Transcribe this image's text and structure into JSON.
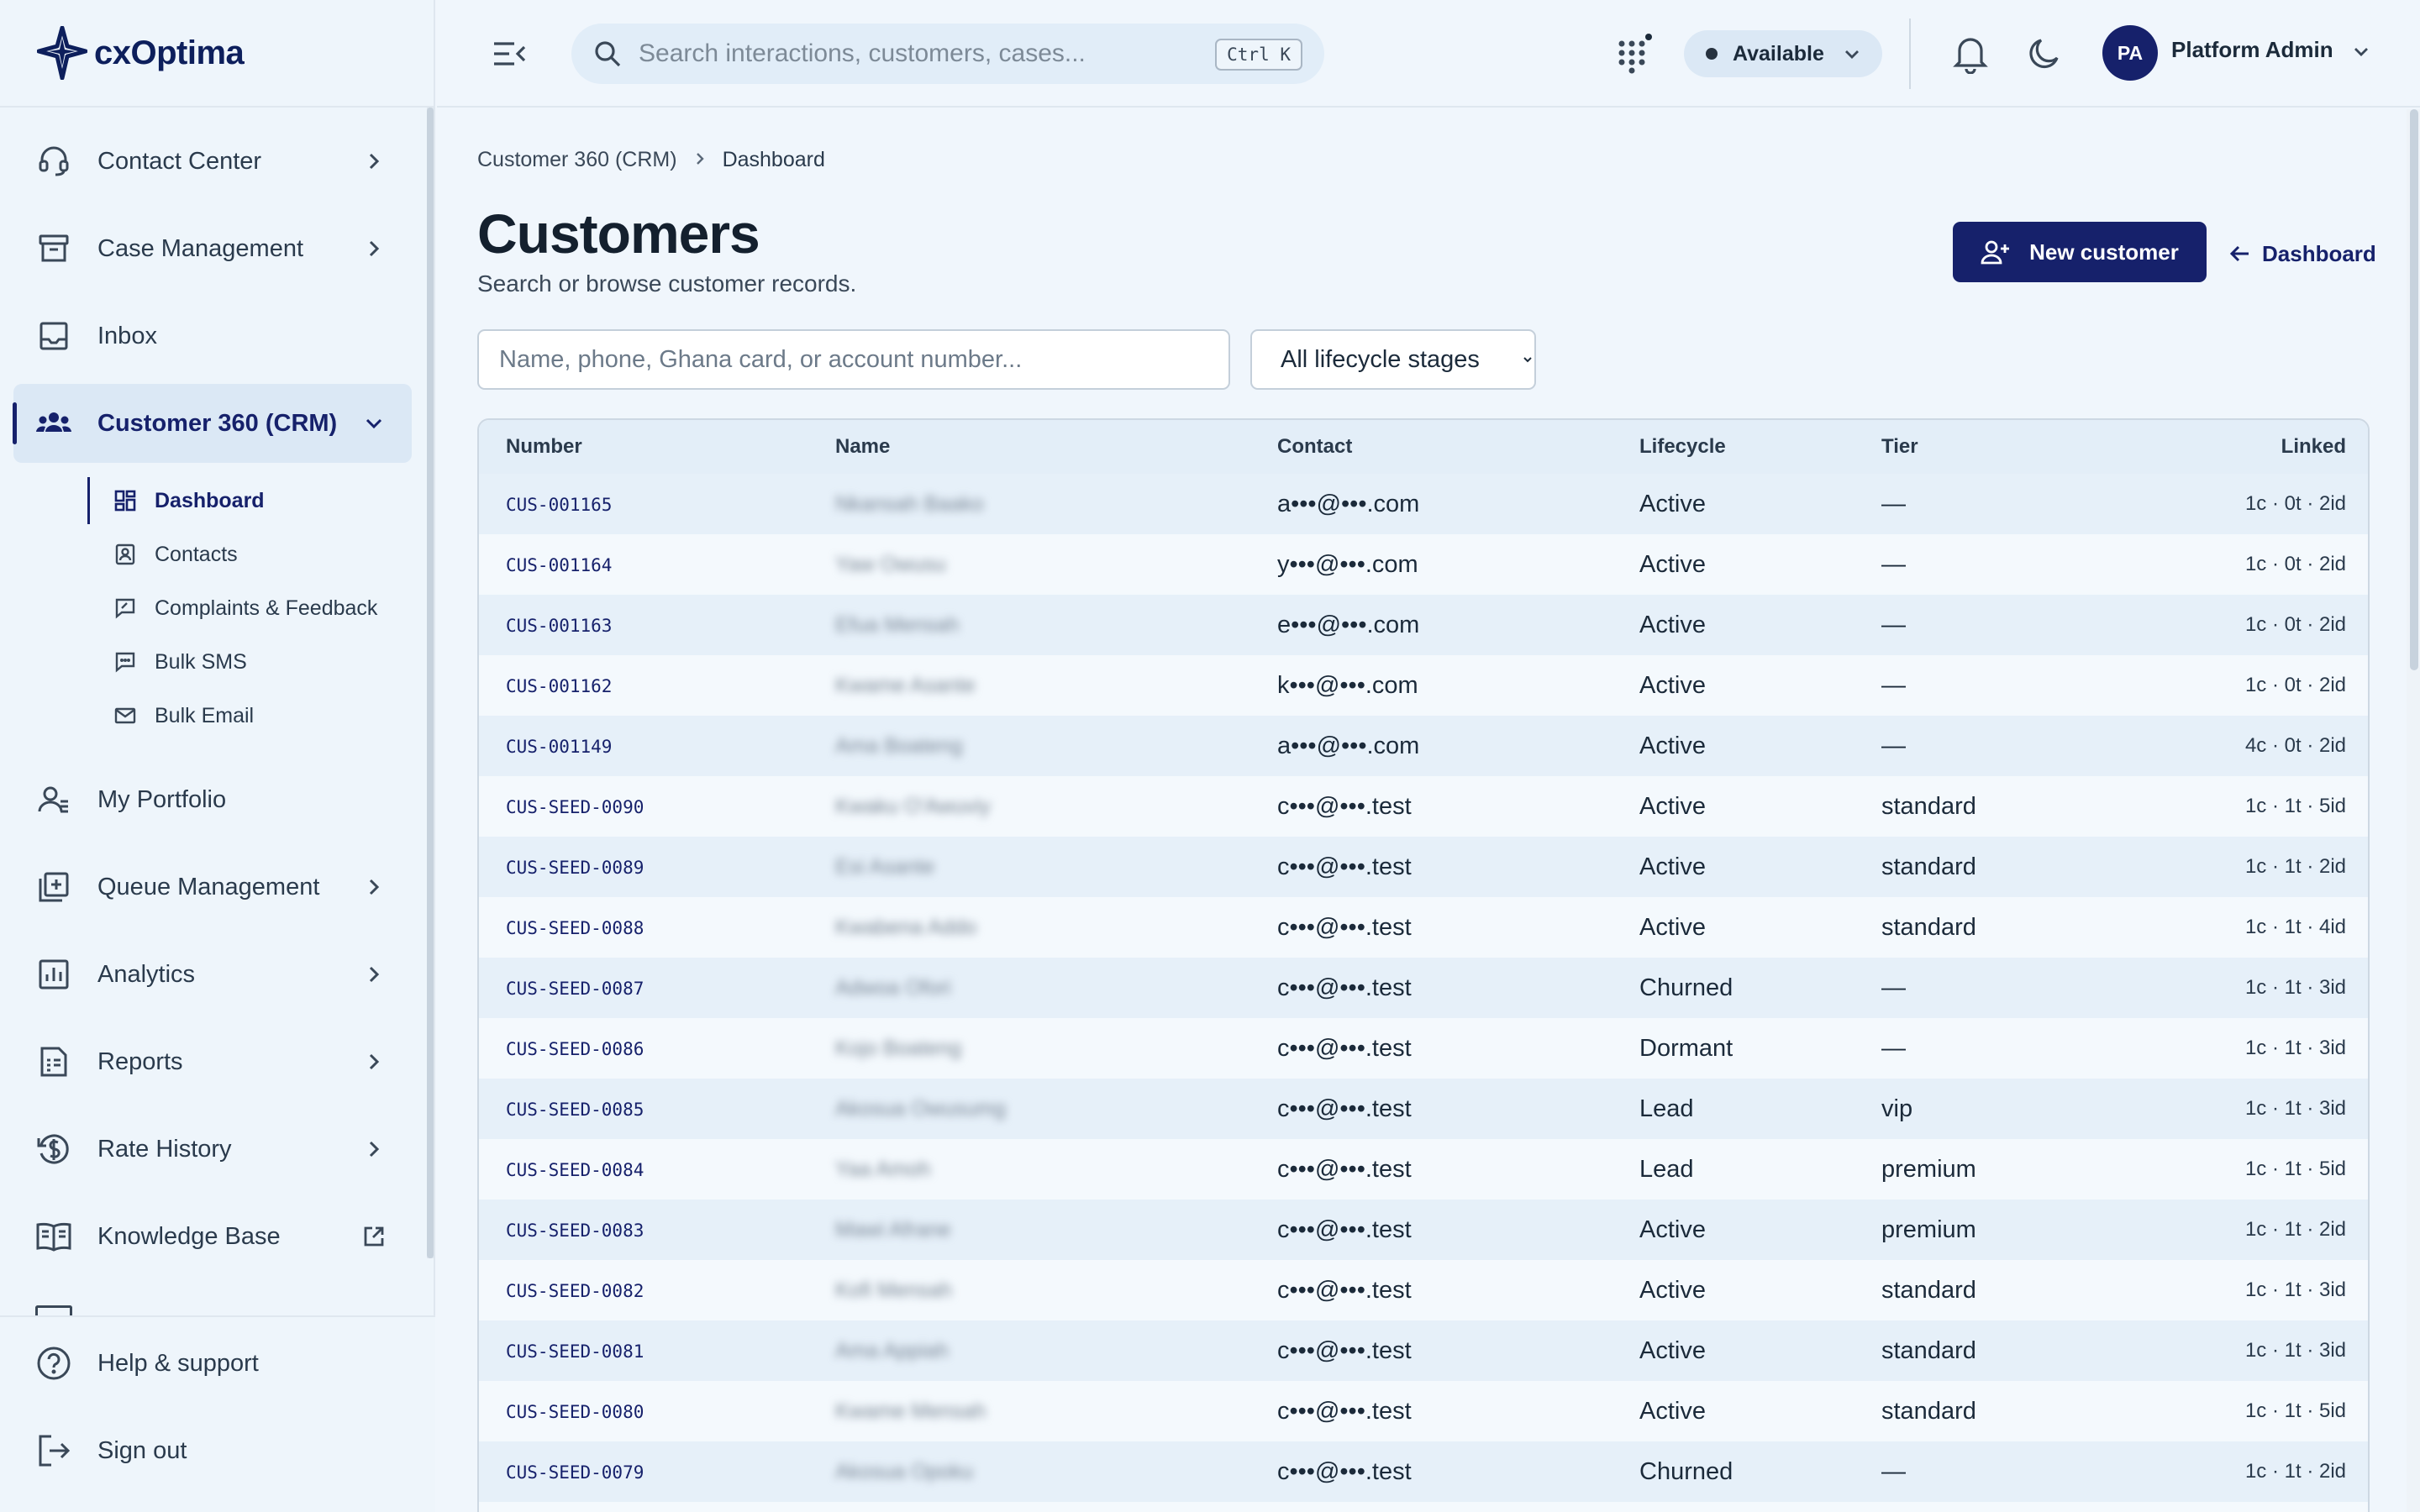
{
  "app": {
    "logo_text": "cxOptima"
  },
  "sidebar": {
    "items": [
      {
        "label": "Contact Center"
      },
      {
        "label": "Case Management"
      },
      {
        "label": "Inbox"
      },
      {
        "label": "Customer 360 (CRM)"
      },
      {
        "label": "My Portfolio"
      },
      {
        "label": "Queue Management"
      },
      {
        "label": "Analytics"
      },
      {
        "label": "Reports"
      },
      {
        "label": "Rate History"
      },
      {
        "label": "Knowledge Base"
      }
    ],
    "subitems": [
      {
        "label": "Dashboard"
      },
      {
        "label": "Contacts"
      },
      {
        "label": "Complaints & Feedback"
      },
      {
        "label": "Bulk SMS"
      },
      {
        "label": "Bulk Email"
      }
    ],
    "bottom": [
      {
        "label": "Help & support"
      },
      {
        "label": "Sign out"
      }
    ]
  },
  "topbar": {
    "search_placeholder": "Search interactions, customers, cases...",
    "shortcut": "Ctrl K",
    "status": "Available",
    "avatar_initials": "PA",
    "user_name": "Platform Admin"
  },
  "breadcrumb": {
    "parent": "Customer 360 (CRM)",
    "current": "Dashboard"
  },
  "page": {
    "title": "Customers",
    "subtitle": "Search or browse customer records.",
    "new_button": "New customer",
    "back_link": "Dashboard",
    "filter_placeholder": "Name, phone, Ghana card, or account number...",
    "stage_selected": "All lifecycle stages"
  },
  "table": {
    "headers": {
      "number": "Number",
      "name": "Name",
      "contact": "Contact",
      "lifecycle": "Lifecycle",
      "tier": "Tier",
      "linked": "Linked"
    },
    "rows": [
      {
        "number": "CUS-001165",
        "name": "Nkansah Baako",
        "contact": "a•••@•••.com",
        "lifecycle": "Active",
        "tier": "—",
        "linked": "1c · 0t · 2id"
      },
      {
        "number": "CUS-001164",
        "name": "Yaw Owusu",
        "contact": "y•••@•••.com",
        "lifecycle": "Active",
        "tier": "—",
        "linked": "1c · 0t · 2id"
      },
      {
        "number": "CUS-001163",
        "name": "Efua Mensah",
        "contact": "e•••@•••.com",
        "lifecycle": "Active",
        "tier": "—",
        "linked": "1c · 0t · 2id"
      },
      {
        "number": "CUS-001162",
        "name": "Kwame Asante",
        "contact": "k•••@•••.com",
        "lifecycle": "Active",
        "tier": "—",
        "linked": "1c · 0t · 2id"
      },
      {
        "number": "CUS-001149",
        "name": "Ama Boateng",
        "contact": "a•••@•••.com",
        "lifecycle": "Active",
        "tier": "—",
        "linked": "4c · 0t · 2id"
      },
      {
        "number": "CUS-SEED-0090",
        "name": "Kwaku O'Awuviy",
        "contact": "c•••@•••.test",
        "lifecycle": "Active",
        "tier": "standard",
        "linked": "1c · 1t · 5id"
      },
      {
        "number": "CUS-SEED-0089",
        "name": "Esi Asante",
        "contact": "c•••@•••.test",
        "lifecycle": "Active",
        "tier": "standard",
        "linked": "1c · 1t · 2id"
      },
      {
        "number": "CUS-SEED-0088",
        "name": "Kwabena Addo",
        "contact": "c•••@•••.test",
        "lifecycle": "Active",
        "tier": "standard",
        "linked": "1c · 1t · 4id"
      },
      {
        "number": "CUS-SEED-0087",
        "name": "Adwoa Ofori",
        "contact": "c•••@•••.test",
        "lifecycle": "Churned",
        "tier": "—",
        "linked": "1c · 1t · 3id"
      },
      {
        "number": "CUS-SEED-0086",
        "name": "Kojo Boateng",
        "contact": "c•••@•••.test",
        "lifecycle": "Dormant",
        "tier": "—",
        "linked": "1c · 1t · 3id"
      },
      {
        "number": "CUS-SEED-0085",
        "name": "Akosua Owusumg",
        "contact": "c•••@•••.test",
        "lifecycle": "Lead",
        "tier": "vip",
        "linked": "1c · 1t · 3id"
      },
      {
        "number": "CUS-SEED-0084",
        "name": "Yaa Amoh",
        "contact": "c•••@•••.test",
        "lifecycle": "Lead",
        "tier": "premium",
        "linked": "1c · 1t · 5id"
      },
      {
        "number": "CUS-SEED-0083",
        "name": "Mawi Afrane",
        "contact": "c•••@•••.test",
        "lifecycle": "Active",
        "tier": "premium",
        "linked": "1c · 1t · 2id"
      },
      {
        "number": "CUS-SEED-0082",
        "name": "Kofi Mensah",
        "contact": "c•••@•••.test",
        "lifecycle": "Active",
        "tier": "standard",
        "linked": "1c · 1t · 3id"
      },
      {
        "number": "CUS-SEED-0081",
        "name": "Ama Appiah",
        "contact": "c•••@•••.test",
        "lifecycle": "Active",
        "tier": "standard",
        "linked": "1c · 1t · 3id"
      },
      {
        "number": "CUS-SEED-0080",
        "name": "Kwame Mensah",
        "contact": "c•••@•••.test",
        "lifecycle": "Active",
        "tier": "standard",
        "linked": "1c · 1t · 5id"
      },
      {
        "number": "CUS-SEED-0079",
        "name": "Akosua Opoku",
        "contact": "c•••@•••.test",
        "lifecycle": "Churned",
        "tier": "—",
        "linked": "1c · 1t · 2id"
      }
    ]
  }
}
